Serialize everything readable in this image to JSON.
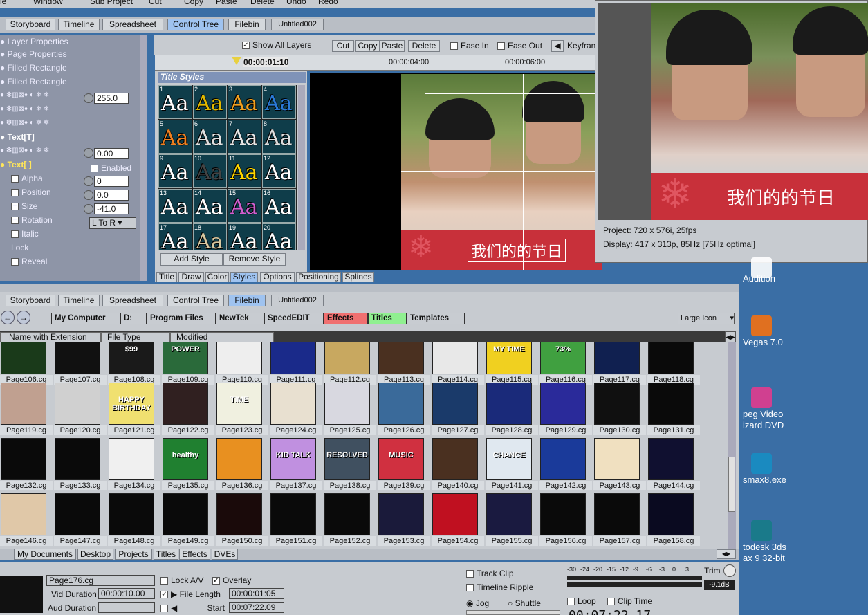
{
  "menu": {
    "items": [
      "le",
      "Window",
      "Sub Project",
      "Cut",
      "Copy",
      "Paste",
      "Delete",
      "Undo",
      "Redo"
    ]
  },
  "tabs_top": {
    "items": [
      "Storyboard",
      "Timeline",
      "Spreadsheet",
      "Control Tree",
      "Filebin"
    ],
    "doc": "Untitled002"
  },
  "toolbar": {
    "show_all_layers": "Show All Layers",
    "cut": "Cut",
    "copy": "Copy",
    "paste": "Paste",
    "delete": "Delete",
    "ease_in": "Ease In",
    "ease_out": "Ease Out",
    "keyframe": "Keyfran"
  },
  "ruler": {
    "current": "00:00:01:10",
    "t4": "00:00:04:00",
    "t6": "00:00:06:00"
  },
  "tree": {
    "layer_props": "Layer Properties",
    "page_props": "Page Properties",
    "filled1": "Filled Rectangle",
    "filled2": "Filled Rectangle",
    "text1": "Text[T]",
    "text2": "Text[ ]",
    "enabled": "Enabled",
    "alpha": "Alpha",
    "position": "Position",
    "size": "Size",
    "rotation": "Rotation",
    "italic": "Italic",
    "lock": "Lock",
    "reveal": "Reveal",
    "val1": "255.0",
    "val2": "0.00",
    "val_alpha": "0",
    "val_pos": "0.0",
    "val_size": "-41.0",
    "rot_mode": "L To R"
  },
  "title_styles": {
    "header": "Title Styles",
    "add": "Add Style",
    "remove": "Remove Style",
    "styles": [
      {
        "n": "1",
        "fg": "#ffffff"
      },
      {
        "n": "2",
        "fg": "#e0b800"
      },
      {
        "n": "3",
        "fg": "#f0a020"
      },
      {
        "n": "4",
        "fg": "#2a7ad8"
      },
      {
        "n": "5",
        "fg": "#f08020"
      },
      {
        "n": "6",
        "fg": "#e0e0e0"
      },
      {
        "n": "7",
        "fg": "#e8e8e8"
      },
      {
        "n": "8",
        "fg": "#dddddd"
      },
      {
        "n": "9",
        "fg": "#ffffff"
      },
      {
        "n": "10",
        "fg": "#444444"
      },
      {
        "n": "11",
        "fg": "#ffd800"
      },
      {
        "n": "12",
        "fg": "#ffffff"
      },
      {
        "n": "13",
        "fg": "#ffffff"
      },
      {
        "n": "14",
        "fg": "#ffffff"
      },
      {
        "n": "15",
        "fg": "#d060d0"
      },
      {
        "n": "16",
        "fg": "#ffffff"
      },
      {
        "n": "17",
        "fg": "#ffffff"
      },
      {
        "n": "18",
        "fg": "#d8c8a0"
      },
      {
        "n": "19",
        "fg": "#ffffff"
      },
      {
        "n": "20",
        "fg": "#ffffff"
      }
    ]
  },
  "bottom_tabs": [
    "Title",
    "Draw",
    "Color",
    "Styles",
    "Options",
    "Positioning",
    "Splines"
  ],
  "monitor": {
    "caption": "我们的的节日",
    "project": "Project: 720 x 576i, 25fps",
    "display": "Display: 417 x 313p, 85Hz [75Hz optimal]"
  },
  "filebin": {
    "tabs": [
      "Storyboard",
      "Timeline",
      "Spreadsheet",
      "Control Tree",
      "Filebin"
    ],
    "doc": "Untitled002",
    "path": [
      {
        "label": "My Computer",
        "color": "#c8ccd1"
      },
      {
        "label": "D:",
        "color": "#c8ccd1"
      },
      {
        "label": "Program Files",
        "color": "#c8ccd1"
      },
      {
        "label": "NewTek",
        "color": "#c8ccd1"
      },
      {
        "label": "SpeedEDIT",
        "color": "#c8ccd1"
      },
      {
        "label": "Effects",
        "color": "#f07070"
      },
      {
        "label": "Titles",
        "color": "#90f090"
      },
      {
        "label": "Templates",
        "color": "#c8ccd1"
      }
    ],
    "view": "Large Icon",
    "columns": [
      "Name with Extension",
      "File Type",
      "Modified"
    ],
    "files": [
      [
        "Page106.cg",
        "Page107.cg",
        "Page108.cg",
        "Page109.cg",
        "Page110.cg",
        "Page111.cg",
        "Page112.cg",
        "Page113.cg",
        "Page114.cg",
        "Page115.cg",
        "Page116.cg",
        "Page117.cg",
        "Page118.cg"
      ],
      [
        "Page119.cg",
        "Page120.cg",
        "Page121.cg",
        "Page122.cg",
        "Page123.cg",
        "Page124.cg",
        "Page125.cg",
        "Page126.cg",
        "Page127.cg",
        "Page128.cg",
        "Page129.cg",
        "Page130.cg",
        "Page131.cg"
      ],
      [
        "Page132.cg",
        "Page133.cg",
        "Page134.cg",
        "Page135.cg",
        "Page136.cg",
        "Page137.cg",
        "Page138.cg",
        "Page139.cg",
        "Page140.cg",
        "Page141.cg",
        "Page142.cg",
        "Page143.cg",
        "Page144.cg"
      ],
      [
        "Page146.cg",
        "Page147.cg",
        "Page148.cg",
        "Page149.cg",
        "Page150.cg",
        "Page151.cg",
        "Page152.cg",
        "Page153.cg",
        "Page154.cg",
        "Page155.cg",
        "Page156.cg",
        "Page157.cg",
        "Page158.cg"
      ]
    ],
    "thumbs": [
      [
        "#1a3a1a",
        "#111111",
        "#1a1a1a",
        "#2a6a3a",
        "#eeeeee",
        "#1a2a8a",
        "#c8a860",
        "#4a3020",
        "#e8e8e8",
        "#f0d020",
        "#40a040",
        "#102050",
        "#0a0a0a"
      ],
      [
        "#c0a090",
        "#d0d0d0",
        "#f0e070",
        "#302020",
        "#f0f0e0",
        "#e8e0d0",
        "#d8d8e0",
        "#3a6a9a",
        "#1a3a6a",
        "#1a2a7a",
        "#2a2a9a",
        "#101010",
        "#0a0a0a"
      ],
      [
        "#0a0a0a",
        "#0a0a0a",
        "#f0f0f0",
        "#208030",
        "#e89020",
        "#c090e0",
        "#405060",
        "#d03040",
        "#4a3020",
        "#e0e8f0",
        "#1a3a9a",
        "#f0e0c0",
        "#101030"
      ],
      [
        "#e0c8a8",
        "#0a0a0a",
        "#0a0a0a",
        "#0a0a0a",
        "#1a0a0a",
        "#0a0a0a",
        "#0a0a0a",
        "#1a1a3a",
        "#c01020",
        "#1a1a40",
        "#0a0a0a",
        "#0a0a0a",
        "#0a0a20"
      ]
    ],
    "texts": {
      "Page108.cg": "$99",
      "Page109.cg": "POWER",
      "Page115.cg": "MY TIME",
      "Page116.cg": "73%",
      "Page121.cg": "HAPPY BIRTHDAY",
      "Page123.cg": "TIME",
      "Page135.cg": "healthy",
      "Page137.cg": "KID TALK",
      "Page138.cg": "RESOLVED",
      "Page139.cg": "MUSIC",
      "Page141.cg": "CHANCE"
    },
    "bottom_tabs": [
      "My Documents",
      "Desktop",
      "Projects",
      "Titles",
      "Effects",
      "DVEs"
    ]
  },
  "bottom": {
    "filename": "Page176.cg",
    "vid_duration_label": "Vid Duration",
    "vid_duration": "00:00:10.00",
    "aud_duration_label": "Aud Duration",
    "lock_av": "Lock A/V",
    "overlay": "Overlay",
    "file_length_label": "File Length",
    "file_length": "00:00:01:05",
    "start_label": "Start",
    "start": "00:07:22.09",
    "track_clip": "Track Clip",
    "timeline_ripple": "Timeline Ripple",
    "jog": "Jog",
    "shuttle": "Shuttle",
    "loop": "Loop",
    "clip_time": "Clip Time",
    "trim": "Trim",
    "db": "-9.1dB",
    "meter_ticks": [
      "-30",
      "-24",
      "-20",
      "-15",
      "-12",
      "-9",
      "-6",
      "-3",
      "0",
      "3"
    ],
    "timecode": "00:07:22.17"
  },
  "desktop": {
    "icons": [
      {
        "label": "Audition",
        "color": "#ffffff"
      },
      {
        "label": "Vegas 7.0",
        "color": "#e07020"
      },
      {
        "label": "peg Video\nizard DVD",
        "color": "#d04090"
      },
      {
        "label": "smax8.exe",
        "color": "#1a8ac0"
      },
      {
        "label": "todesk 3ds\nax 9 32-bit",
        "color": "#1a7a8a"
      }
    ]
  }
}
